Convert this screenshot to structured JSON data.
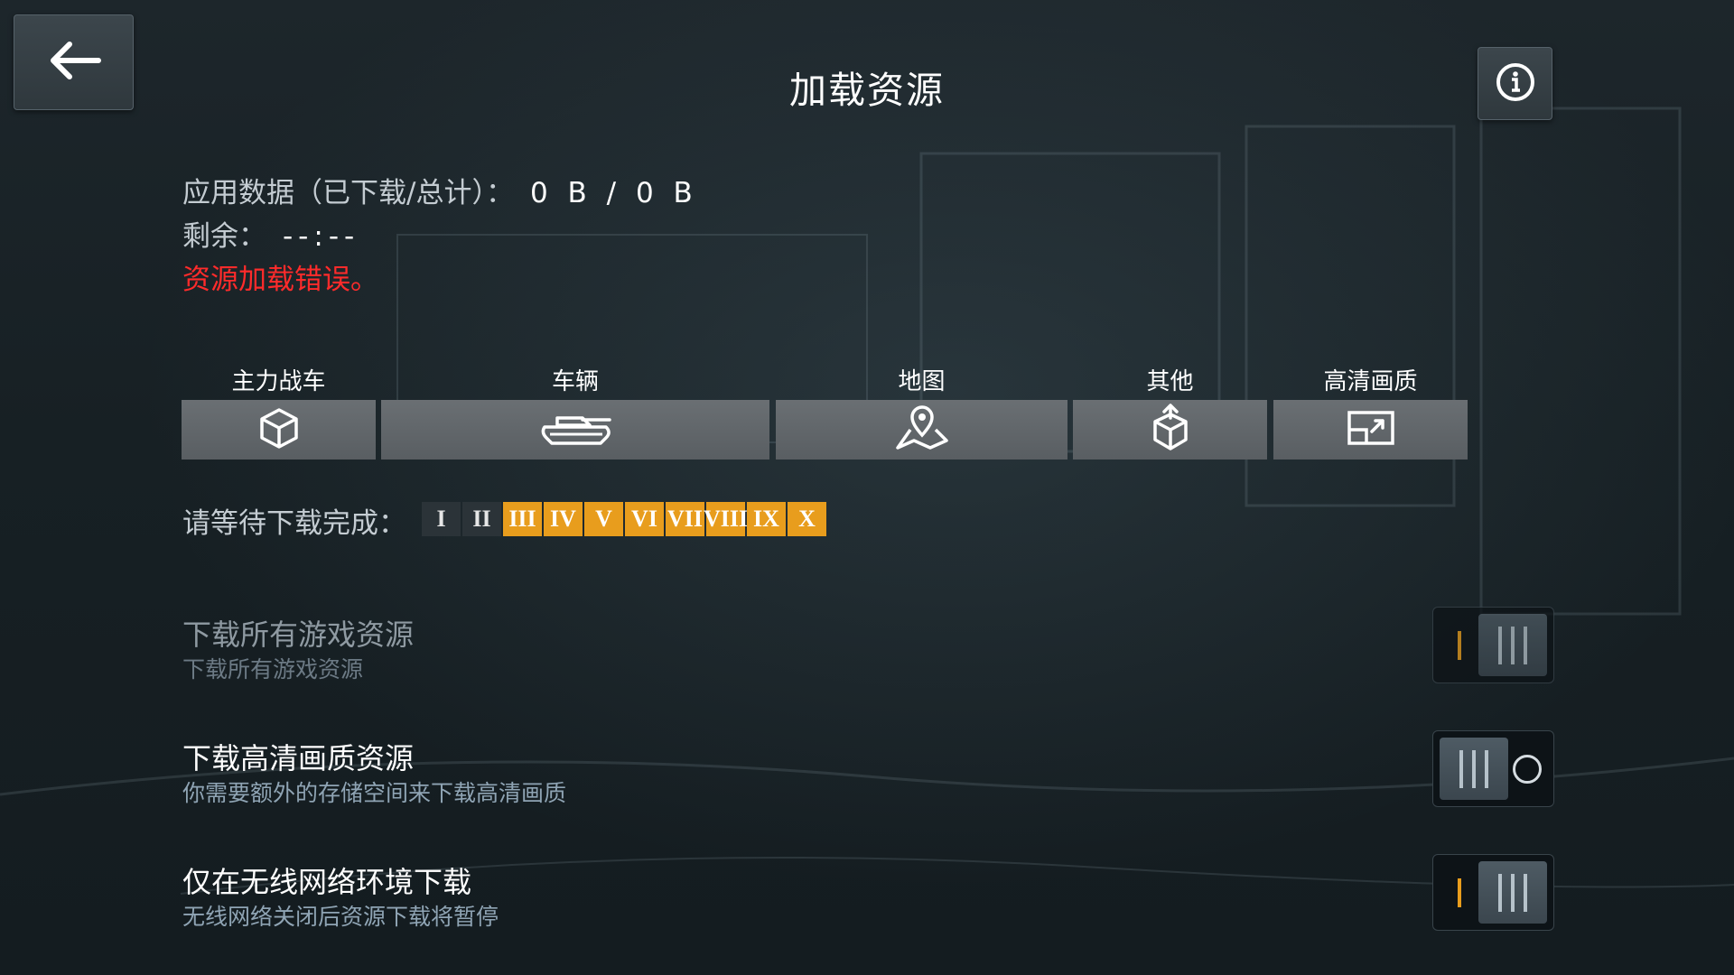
{
  "header": {
    "title": "加载资源",
    "back_icon": "arrow-left-icon",
    "info_icon": "info-icon"
  },
  "status": {
    "data_label": "应用数据（已下载/总计）：",
    "data_value": "0 B / 0 B",
    "remaining_label": "剩余：",
    "remaining_value": "--:--",
    "error": "资源加载错误。"
  },
  "categories": [
    {
      "label": "主力战车",
      "icon": "cube-icon"
    },
    {
      "label": "车辆",
      "icon": "tank-icon"
    },
    {
      "label": "地图",
      "icon": "map-pin-icon"
    },
    {
      "label": "其他",
      "icon": "box-upload-icon"
    },
    {
      "label": "高清画质",
      "icon": "hd-screen-icon"
    }
  ],
  "tiers": {
    "label": "请等待下载完成：",
    "items": [
      {
        "label": "I",
        "state": "done"
      },
      {
        "label": "II",
        "state": "done"
      },
      {
        "label": "III",
        "state": "pending"
      },
      {
        "label": "IV",
        "state": "pending"
      },
      {
        "label": "V",
        "state": "pending"
      },
      {
        "label": "VI",
        "state": "pending"
      },
      {
        "label": "VII",
        "state": "pending"
      },
      {
        "label": "VIII",
        "state": "pending"
      },
      {
        "label": "IX",
        "state": "pending"
      },
      {
        "label": "X",
        "state": "pending"
      }
    ]
  },
  "options": [
    {
      "title": "下载所有游戏资源",
      "subtitle": "下载所有游戏资源",
      "enabled": true,
      "disabled": true
    },
    {
      "title": "下载高清画质资源",
      "subtitle": "你需要额外的存储空间来下载高清画质",
      "enabled": false,
      "disabled": false
    },
    {
      "title": "仅在无线网络环境下载",
      "subtitle": "无线网络关闭后资源下载将暂停",
      "enabled": true,
      "disabled": false
    }
  ],
  "colors": {
    "accent": "#e89d1d",
    "error": "#ff2b2b",
    "tier_done": "#2b3338"
  }
}
